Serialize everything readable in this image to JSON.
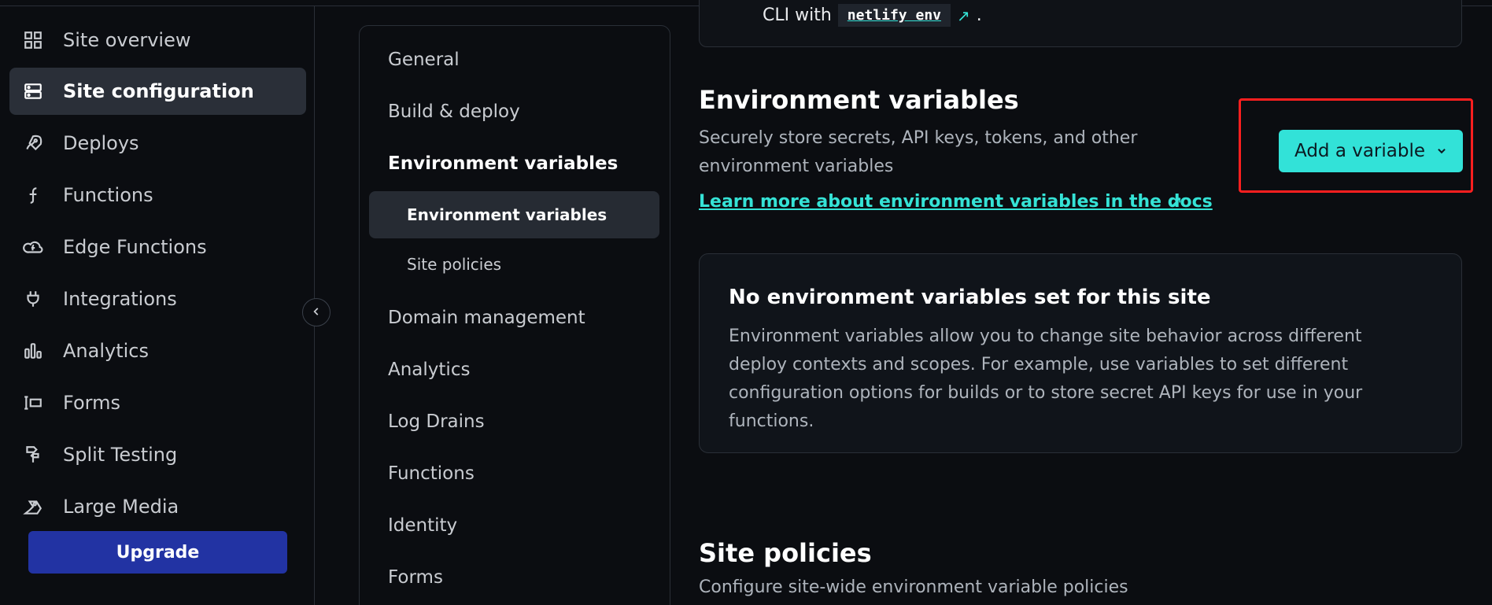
{
  "sidebar": {
    "items": [
      {
        "label": "Site overview",
        "icon": "grid-icon",
        "active": false
      },
      {
        "label": "Site configuration",
        "icon": "server-icon",
        "active": true
      },
      {
        "label": "Deploys",
        "icon": "rocket-icon",
        "active": false
      },
      {
        "label": "Functions",
        "icon": "function-icon",
        "active": false
      },
      {
        "label": "Edge Functions",
        "icon": "cloud-function-icon",
        "active": false
      },
      {
        "label": "Integrations",
        "icon": "plug-icon",
        "active": false
      },
      {
        "label": "Analytics",
        "icon": "bar-chart-icon",
        "active": false
      },
      {
        "label": "Forms",
        "icon": "forms-icon",
        "active": false
      },
      {
        "label": "Split Testing",
        "icon": "split-icon",
        "active": false
      },
      {
        "label": "Large Media",
        "icon": "media-icon",
        "active": false
      }
    ],
    "upgrade_label": "Upgrade"
  },
  "subnav": {
    "general": "General",
    "build_deploy": "Build & deploy",
    "env_vars": "Environment variables",
    "env_vars_child": "Environment variables",
    "site_policies_child": "Site policies",
    "domain_management": "Domain management",
    "analytics": "Analytics",
    "log_drains": "Log Drains",
    "functions": "Functions",
    "identity": "Identity",
    "forms": "Forms"
  },
  "main": {
    "cli_prefix": "CLI with",
    "cli_code": "netlify env",
    "cli_suffix": ".",
    "env_title": "Environment variables",
    "env_description": "Securely store secrets, API keys, tokens, and other environment variables",
    "learn_more": "Learn more about environment variables in the docs",
    "add_variable": "Add a variable",
    "empty_title": "No environment variables set for this site",
    "empty_body": "Environment variables allow you to change site behavior across different deploy contexts and scopes. For example, use variables to set different configuration options for builds or to store secret API keys for use in your functions.",
    "site_policies_title": "Site policies",
    "site_policies_desc": "Configure site-wide environment variable policies"
  },
  "colors": {
    "accent": "#32e2d8",
    "upgrade": "#2233a3",
    "highlight": "#ff1f1f",
    "background": "#0b0d11"
  }
}
